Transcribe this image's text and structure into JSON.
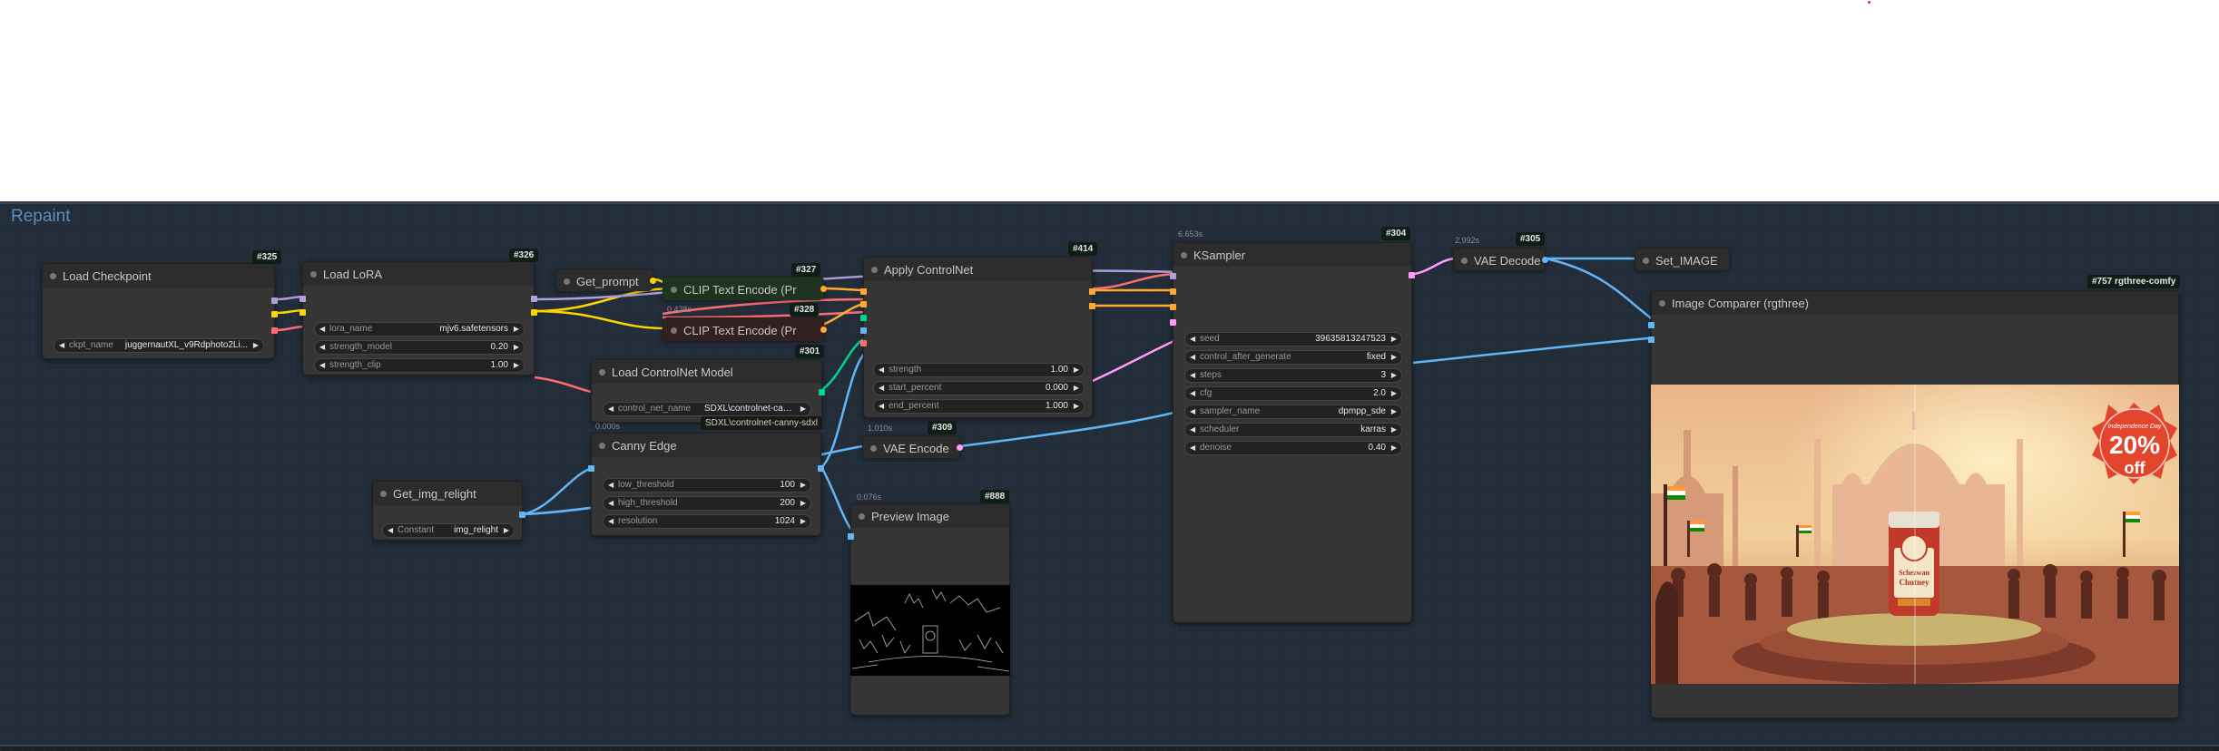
{
  "group": {
    "title": "Repaint"
  },
  "nodes": {
    "load_checkpoint": {
      "title": "Load Checkpoint",
      "id": "#325",
      "widgets": [
        {
          "label": "ckpt_name",
          "value": "juggernautXL_v9Rdphoto2Li..."
        }
      ]
    },
    "load_lora": {
      "title": "Load LoRA",
      "id": "#326",
      "widgets": [
        {
          "label": "lora_name",
          "value": "mjv6.safetensors"
        },
        {
          "label": "strength_model",
          "value": "0.20"
        },
        {
          "label": "strength_clip",
          "value": "1.00"
        }
      ]
    },
    "get_prompt": {
      "title": "Get_prompt"
    },
    "clip_text_encode_pos": {
      "title": "CLIP Text Encode (Pr",
      "id": "#327"
    },
    "clip_text_encode_neg": {
      "title": "CLIP Text Encode (Pr",
      "id": "#328",
      "time": "0.438s"
    },
    "load_controlnet": {
      "title": "Load ControlNet Model",
      "id": "#301",
      "widgets": [
        {
          "label": "control_net_name",
          "value": "SDXL\\controlnet-can..."
        }
      ]
    },
    "canny_edge": {
      "title": "Canny Edge",
      "time": "0.000s",
      "hidden_text": "SDXL\\controlnet-canny-sdxl",
      "widgets": [
        {
          "label": "low_threshold",
          "value": "100"
        },
        {
          "label": "high_threshold",
          "value": "200"
        },
        {
          "label": "resolution",
          "value": "1024"
        }
      ]
    },
    "get_img_relight": {
      "title": "Get_img_relight",
      "widgets": [
        {
          "label": "Constant",
          "value": "img_relight"
        }
      ]
    },
    "apply_controlnet": {
      "title": "Apply ControlNet",
      "id": "#414",
      "widgets": [
        {
          "label": "strength",
          "value": "1.00"
        },
        {
          "label": "start_percent",
          "value": "0.000"
        },
        {
          "label": "end_percent",
          "value": "1.000"
        }
      ]
    },
    "vae_encode": {
      "title": "VAE Encode",
      "id": "#309",
      "time": "1.010s"
    },
    "preview_image": {
      "title": "Preview Image",
      "id": "#888",
      "time": "0.076s"
    },
    "ksampler": {
      "title": "KSampler",
      "id": "#304",
      "time": "6.653s",
      "widgets": [
        {
          "label": "seed",
          "value": "396358132475​23"
        },
        {
          "label": "control_after_generate",
          "value": "fixed"
        },
        {
          "label": "steps",
          "value": "3"
        },
        {
          "label": "cfg",
          "value": "2.0"
        },
        {
          "label": "sampler_name",
          "value": "dpmpp_sde"
        },
        {
          "label": "scheduler",
          "value": "karras"
        },
        {
          "label": "denoise",
          "value": "0.40"
        }
      ]
    },
    "vae_decode": {
      "title": "VAE Decode",
      "id": "#305",
      "time": "2.992s"
    },
    "set_image": {
      "title": "Set_IMAGE"
    },
    "image_comparer": {
      "title": "Image Comparer (rgthree)",
      "id": "#757 rgthree-comfy"
    }
  },
  "poster": {
    "badge_line1": "Independence Day",
    "badge_big": "20%",
    "badge_small": "off",
    "jar_line1": "Schezwan",
    "jar_line2": "Chutney"
  },
  "colors": {
    "model": "#b39ddb",
    "clip": "#ffd500",
    "conditioning": "#ffa931",
    "vae": "#ff6e6e",
    "image": "#64b5f6",
    "latent": "#ff9cf9",
    "control_net": "#00d78d"
  }
}
